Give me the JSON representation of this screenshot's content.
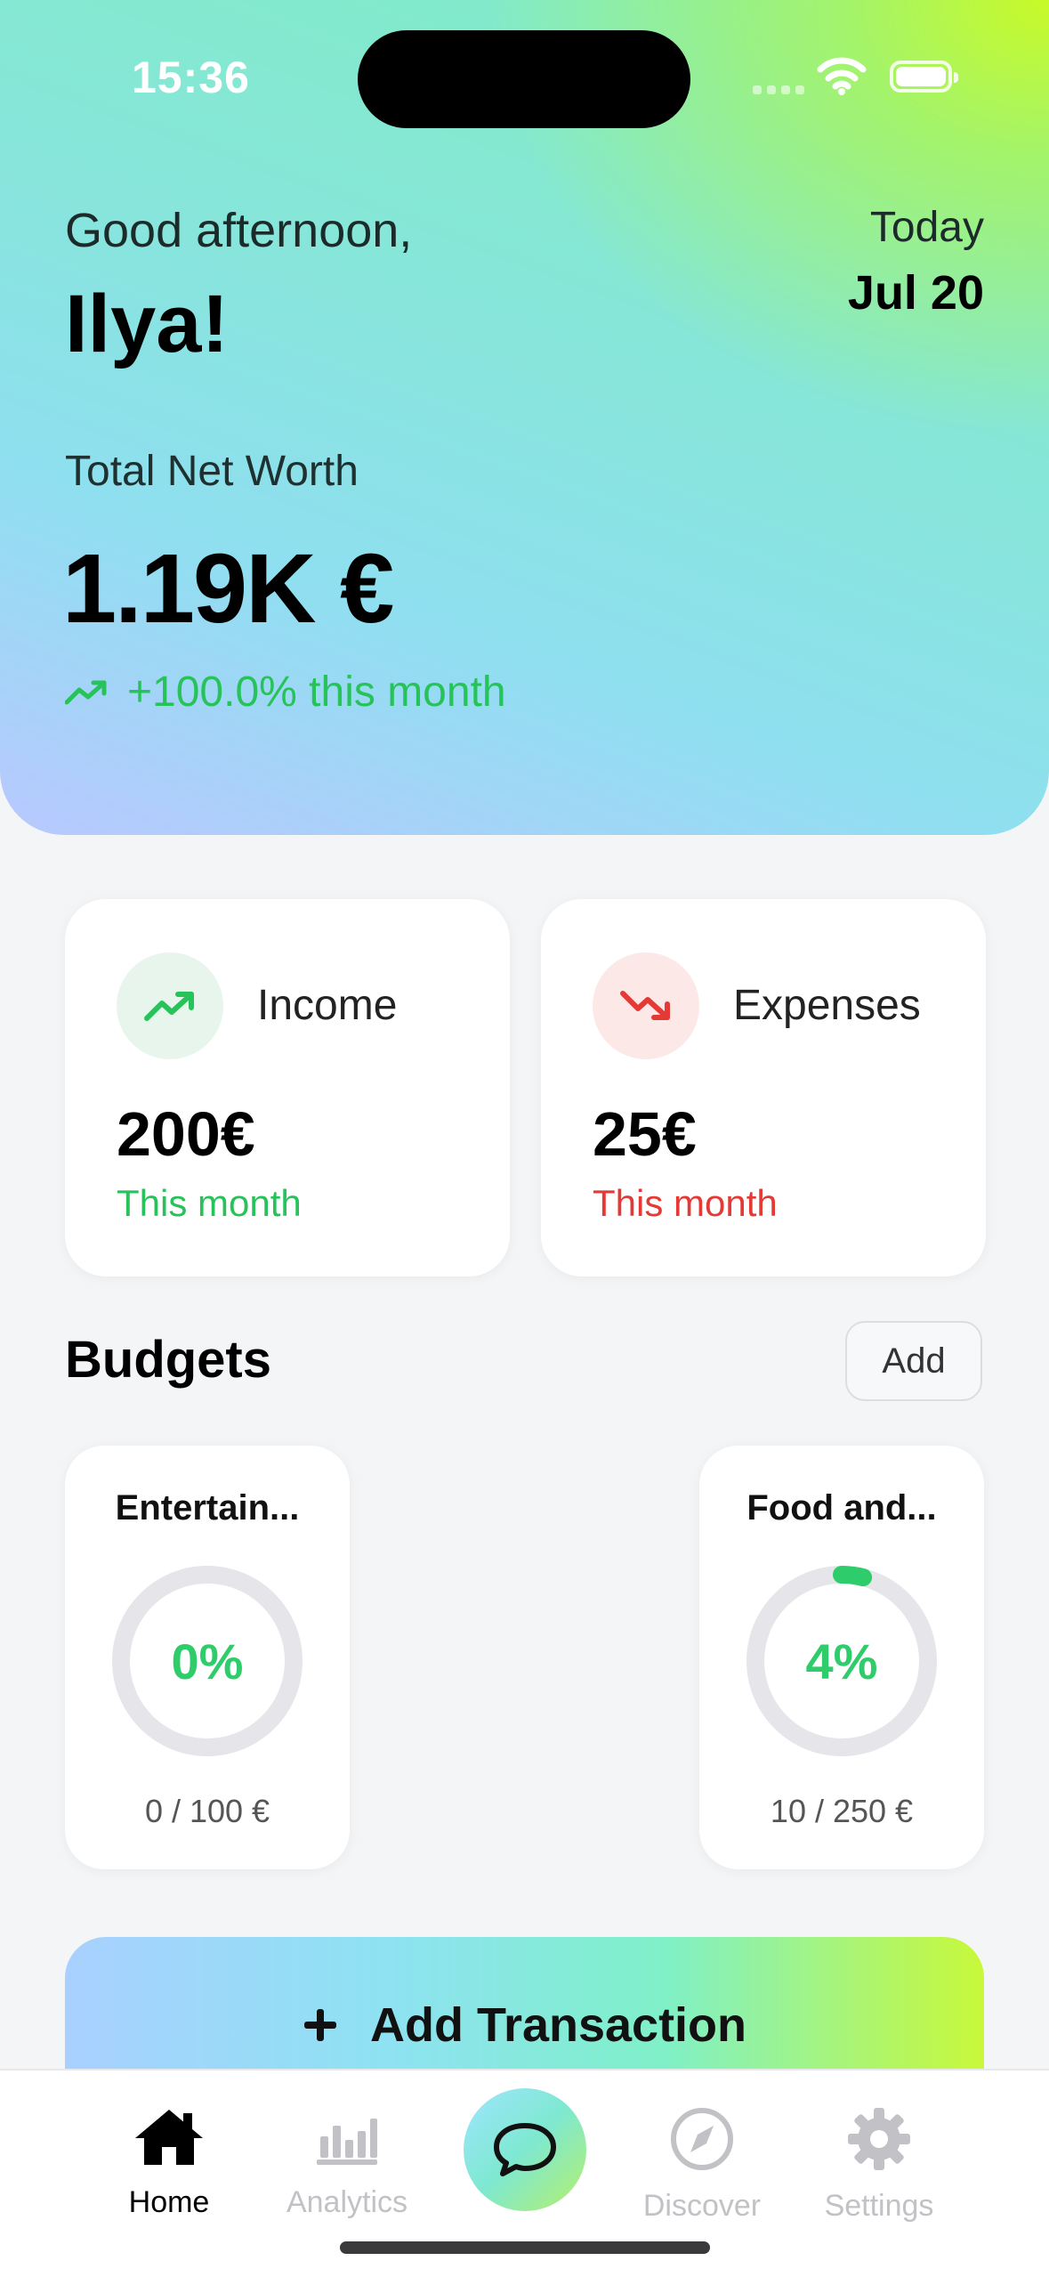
{
  "status": {
    "time": "15:36"
  },
  "header": {
    "greeting": "Good afternoon,",
    "name": "Ilya!",
    "today_label": "Today",
    "date": "Jul 20",
    "net_worth_label": "Total Net Worth",
    "net_worth_value": "1.19K €",
    "trend_text": "+100.0% this month"
  },
  "income": {
    "title": "Income",
    "amount": "200€",
    "period": "This month",
    "color": "#27c35a"
  },
  "expenses": {
    "title": "Expenses",
    "amount": "25€",
    "period": "This month",
    "color": "#e53935"
  },
  "budgets": {
    "title": "Budgets",
    "add_label": "Add",
    "items": [
      {
        "name": "Entertain...",
        "percent_label": "0%",
        "progress": 0.0,
        "amount": "0 / 100 €"
      },
      {
        "name": "Food and...",
        "percent_label": "4%",
        "progress": 0.04,
        "amount": "10 / 250 €"
      }
    ]
  },
  "add_transaction": {
    "label": "Add Transaction"
  },
  "tabs": [
    {
      "label": "Home",
      "icon": "home-icon",
      "active": true
    },
    {
      "label": "Analytics",
      "icon": "chart-bars-icon",
      "active": false
    },
    {
      "label": "",
      "icon": "chat-bubble-icon",
      "active": false
    },
    {
      "label": "Discover",
      "icon": "compass-icon",
      "active": false
    },
    {
      "label": "Settings",
      "icon": "gear-icon",
      "active": false
    }
  ]
}
